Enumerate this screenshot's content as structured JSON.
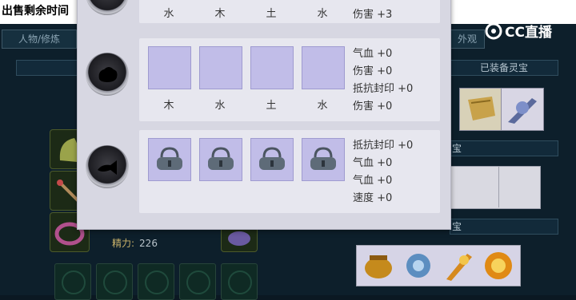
{
  "top_bar": {
    "sale_time_label": "出售剩余时间"
  },
  "tabs": {
    "character": "人物/修炼",
    "appearance": "外观"
  },
  "panels": {
    "equipped_treasure": "已装备灵宝",
    "treasure_label_2": "宝",
    "treasure_label_3": "宝"
  },
  "character": {
    "energy_label": "精力:",
    "energy_value": "226"
  },
  "watermark": {
    "text": "CC直播",
    "icon": "cc-logo-icon"
  },
  "popup": {
    "rows": [
      {
        "elements": [
          "水",
          "木",
          "土",
          "水"
        ],
        "stats": [
          "伤害 +3"
        ]
      },
      {
        "elements": [
          "木",
          "水",
          "土",
          "水"
        ],
        "stats": [
          "气血 +0",
          "伤害 +0",
          "抵抗封印 +0",
          "伤害 +0"
        ]
      },
      {
        "elements": [],
        "stats": [
          "抵抗封印 +0",
          "气血 +0",
          "气血 +0",
          "速度 +0"
        ],
        "slots_locked": true
      }
    ]
  },
  "colors": {
    "popup_bg": "#d7d7e2",
    "slot_fill": "#c1bde8",
    "bg": "#0d1f2b"
  }
}
